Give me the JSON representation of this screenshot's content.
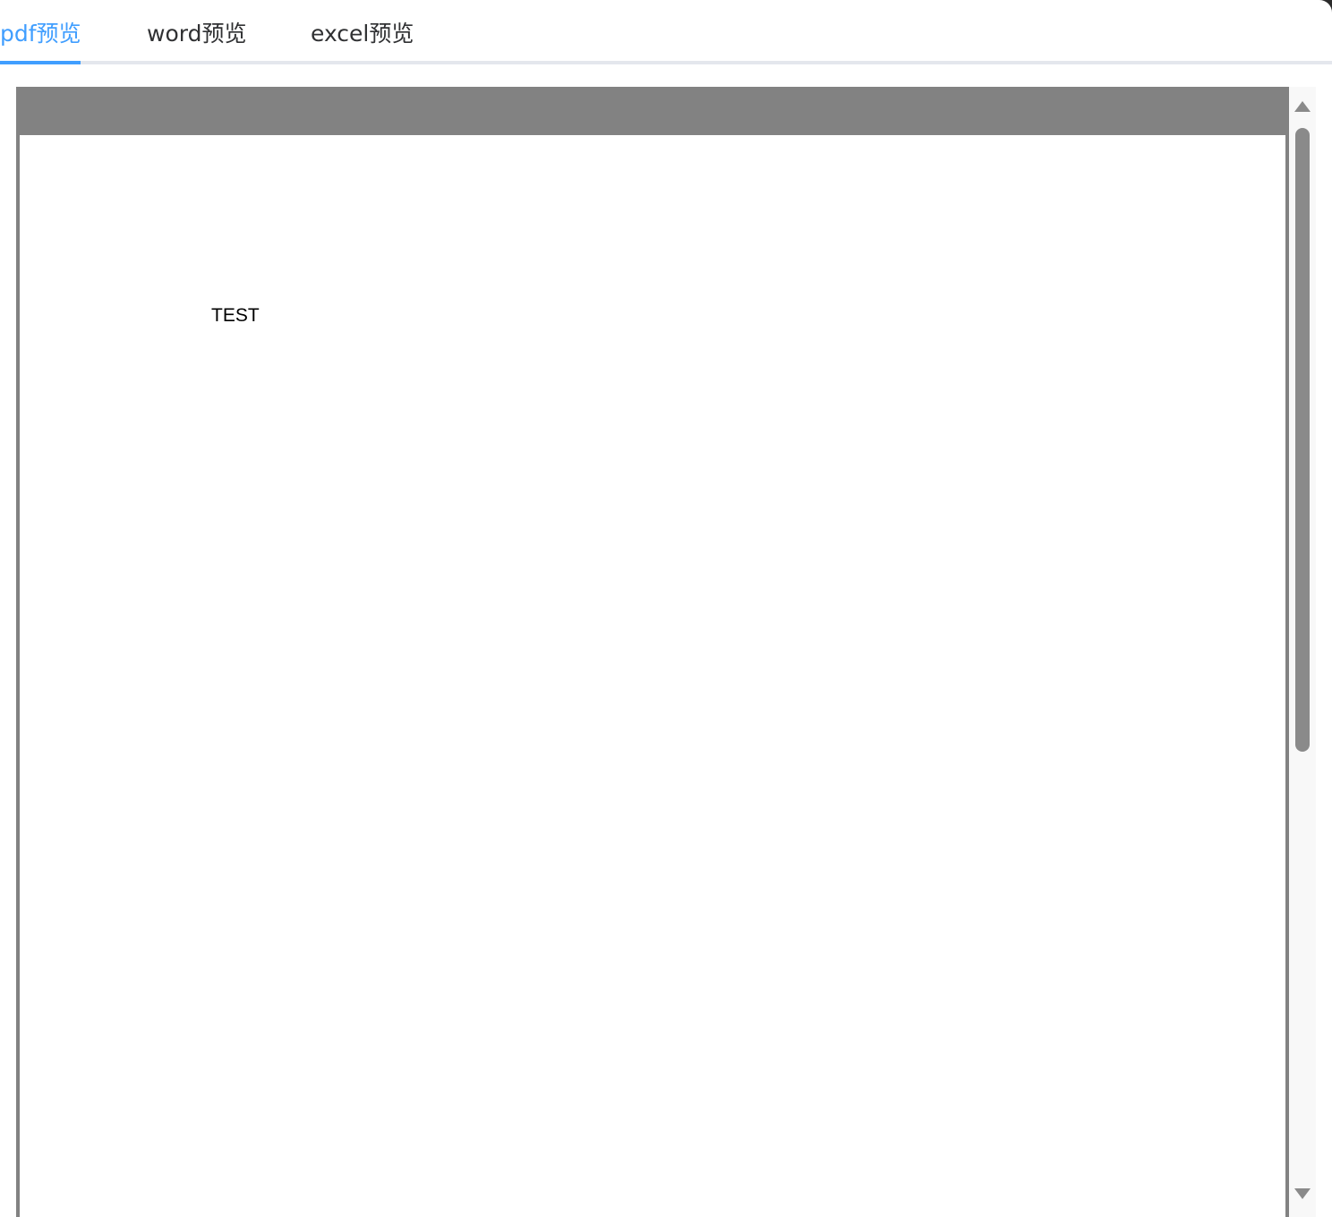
{
  "tabs": {
    "items": [
      {
        "label": "pdf预览",
        "active": true
      },
      {
        "label": "word预览",
        "active": false
      },
      {
        "label": "excel预览",
        "active": false
      }
    ],
    "accent_color": "#409eff",
    "text_color": "#303133"
  },
  "viewer": {
    "background_color": "#828282",
    "page": {
      "text": "TEST"
    }
  },
  "scrollbar": {
    "up_icon": "triangle-up-icon",
    "down_icon": "triangle-down-icon",
    "thumb_color": "#8a8a8a"
  }
}
